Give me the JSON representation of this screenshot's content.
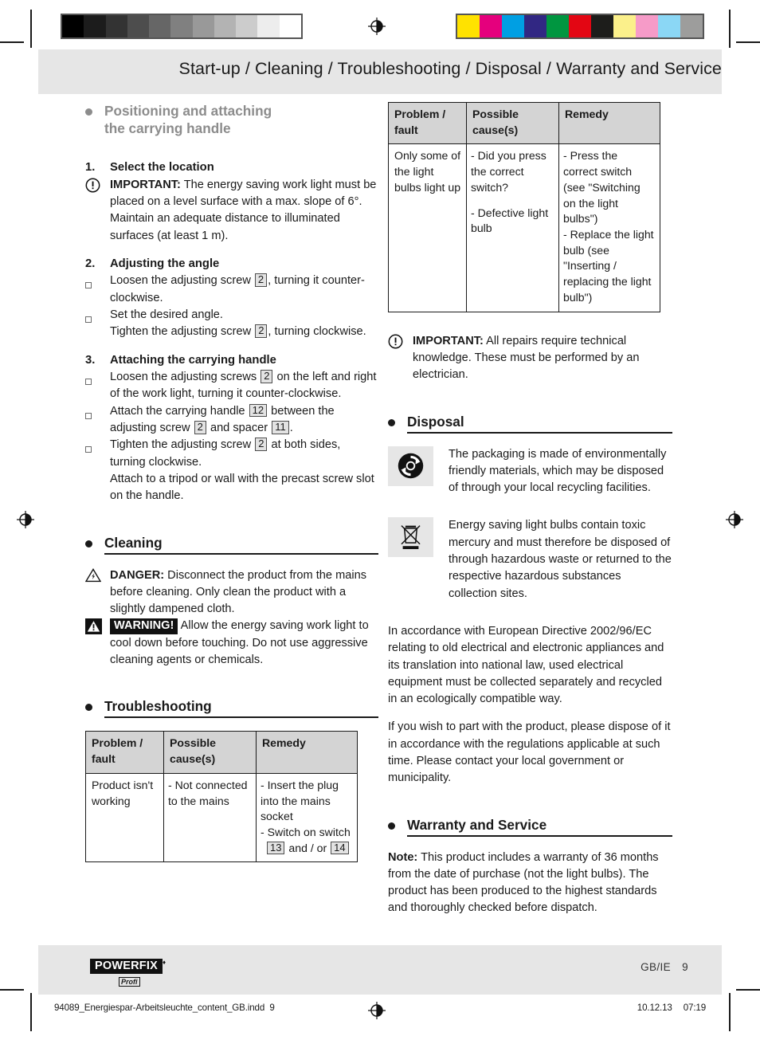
{
  "header": {
    "title": "Start-up / Cleaning / Troubleshooting / Disposal / Warranty and Service"
  },
  "print_marks": {
    "grayscale_swatches": [
      "#000000",
      "#1c1c1c",
      "#333333",
      "#4d4d4d",
      "#666666",
      "#808080",
      "#999999",
      "#b3b3b3",
      "#cccccc",
      "#ededed",
      "#ffffff"
    ],
    "color_swatches": [
      "#ffe200",
      "#e5007d",
      "#009fe3",
      "#312783",
      "#009640",
      "#e30613",
      "#1d1d1b",
      "#fbf08b",
      "#f69bc8",
      "#8bd7f5",
      "#9d9d9c"
    ]
  },
  "left_column": {
    "section1": {
      "heading_line1": "Positioning and attaching",
      "heading_line2": "the carrying handle",
      "steps": [
        {
          "number": "1.",
          "title": "Select the location",
          "important_label": "IMPORTANT:",
          "important_text": "The energy saving work light must be placed on a level surface with a max. slope of 6°. Maintain an adequate distance to illuminated surfaces (at least 1 m)."
        },
        {
          "number": "2.",
          "title": "Adjusting the angle"
        },
        {
          "number": "3.",
          "title": "Attaching the carrying handle"
        }
      ],
      "step2_items": [
        {
          "text_before": "Loosen the adjusting screw",
          "ref1": "2",
          "text_after": ", turning it counter-clockwise."
        },
        {
          "line1": "Set the desired angle.",
          "text_before": "Tighten the adjusting screw",
          "ref1": "2",
          "text_after": ", turning clockwise."
        }
      ],
      "step3_items": [
        {
          "text_before": "Loosen the adjusting screws",
          "ref1": "2",
          "text_after": "on the left and right of the work light, turning it counter-clockwise."
        },
        {
          "text_before": "Attach the carrying handle",
          "ref1": "12",
          "text_mid": "between the adjusting screw",
          "ref2": "2",
          "text_mid2": "and spacer",
          "ref3": "11",
          "text_after": "."
        },
        {
          "text_before": "Tighten the adjusting screw",
          "ref1": "2",
          "text_after": "at both sides, turning clockwise.",
          "extra_line": "Attach to a tripod or wall with the precast screw slot on the handle."
        }
      ]
    },
    "cleaning": {
      "heading": "Cleaning",
      "danger_label": "DANGER:",
      "danger_text": "Disconnect the product from the mains before cleaning. Only clean the product with a slightly dampened cloth.",
      "warning_label": "WARNING!",
      "warning_text": "Allow the energy saving work light to cool down before touching. Do not use aggressive cleaning agents or chemicals."
    },
    "troubleshooting": {
      "heading": "Troubleshooting",
      "table": {
        "headers": [
          "Problem / fault",
          "Possible cause(s)",
          "Remedy"
        ],
        "header_lines": [
          [
            "Problem /",
            "fault"
          ],
          [
            "Possible",
            "cause(s)"
          ],
          [
            "Remedy"
          ]
        ],
        "rows": [
          {
            "problem": "Product isn't working",
            "causes": [
              "- Not connected to the mains"
            ],
            "remedy_lines": [
              "- Insert the plug into the mains socket"
            ],
            "remedy_switch_prefix": "- Switch on switch",
            "remedy_ref1": "13",
            "remedy_switch_mid": "and / or",
            "remedy_ref2": "14"
          }
        ]
      }
    }
  },
  "right_column": {
    "table": {
      "header_lines": [
        [
          "Problem /",
          "fault"
        ],
        [
          "Possible",
          "cause(s)"
        ],
        [
          "Remedy"
        ]
      ],
      "rows": [
        {
          "problem": "Only some of the light bulbs light up",
          "causes": [
            "- Did you press the correct switch?",
            "- Defective light bulb"
          ],
          "remedies": [
            "- Press the correct switch (see \"Switching on the light bulbs\")",
            "- Replace the light bulb (see \"Inserting / replacing the light bulb\")"
          ]
        }
      ]
    },
    "important": {
      "label": "IMPORTANT:",
      "text": "All repairs require technical knowledge. These must be performed by an electrician."
    },
    "disposal": {
      "heading": "Disposal",
      "blocks": [
        {
          "icon": "green-dot-recycling-icon",
          "text": "The packaging is made of environmentally friendly materials, which may be disposed of through your local recycling facilities."
        },
        {
          "icon": "crossed-out-wheelie-bin-icon",
          "text": "Energy saving light bulbs contain toxic mercury and must therefore be disposed of through hazardous waste or returned to the respective hazardous substances collection sites."
        }
      ],
      "paragraph1": "In accordance with European Directive 2002/96/EC relating to old electrical and electronic appliances and its translation into national law, used electrical equipment must be collected separately and recycled in an ecologically compatible way.",
      "paragraph2": "If you wish to part with the product, please dispose of it in accordance with the regulations applicable at such time. Please contact your local government or municipality."
    },
    "warranty": {
      "heading": "Warranty and Service",
      "note_label": "Note:",
      "note_text": "This product includes a warranty of 36 months from the date of purchase (not the light bulbs). The product has been produced to the highest standards and thoroughly checked before dispatch."
    }
  },
  "footer": {
    "logo_main": "POWERFIX",
    "logo_sub": "Profi",
    "locale": "GB/IE",
    "page_number": "9",
    "imprint_file": "94089_Energiespar-Arbeitsleuchte_content_GB.indd",
    "imprint_page": "9",
    "imprint_date": "10.12.13",
    "imprint_time": "07:19"
  }
}
